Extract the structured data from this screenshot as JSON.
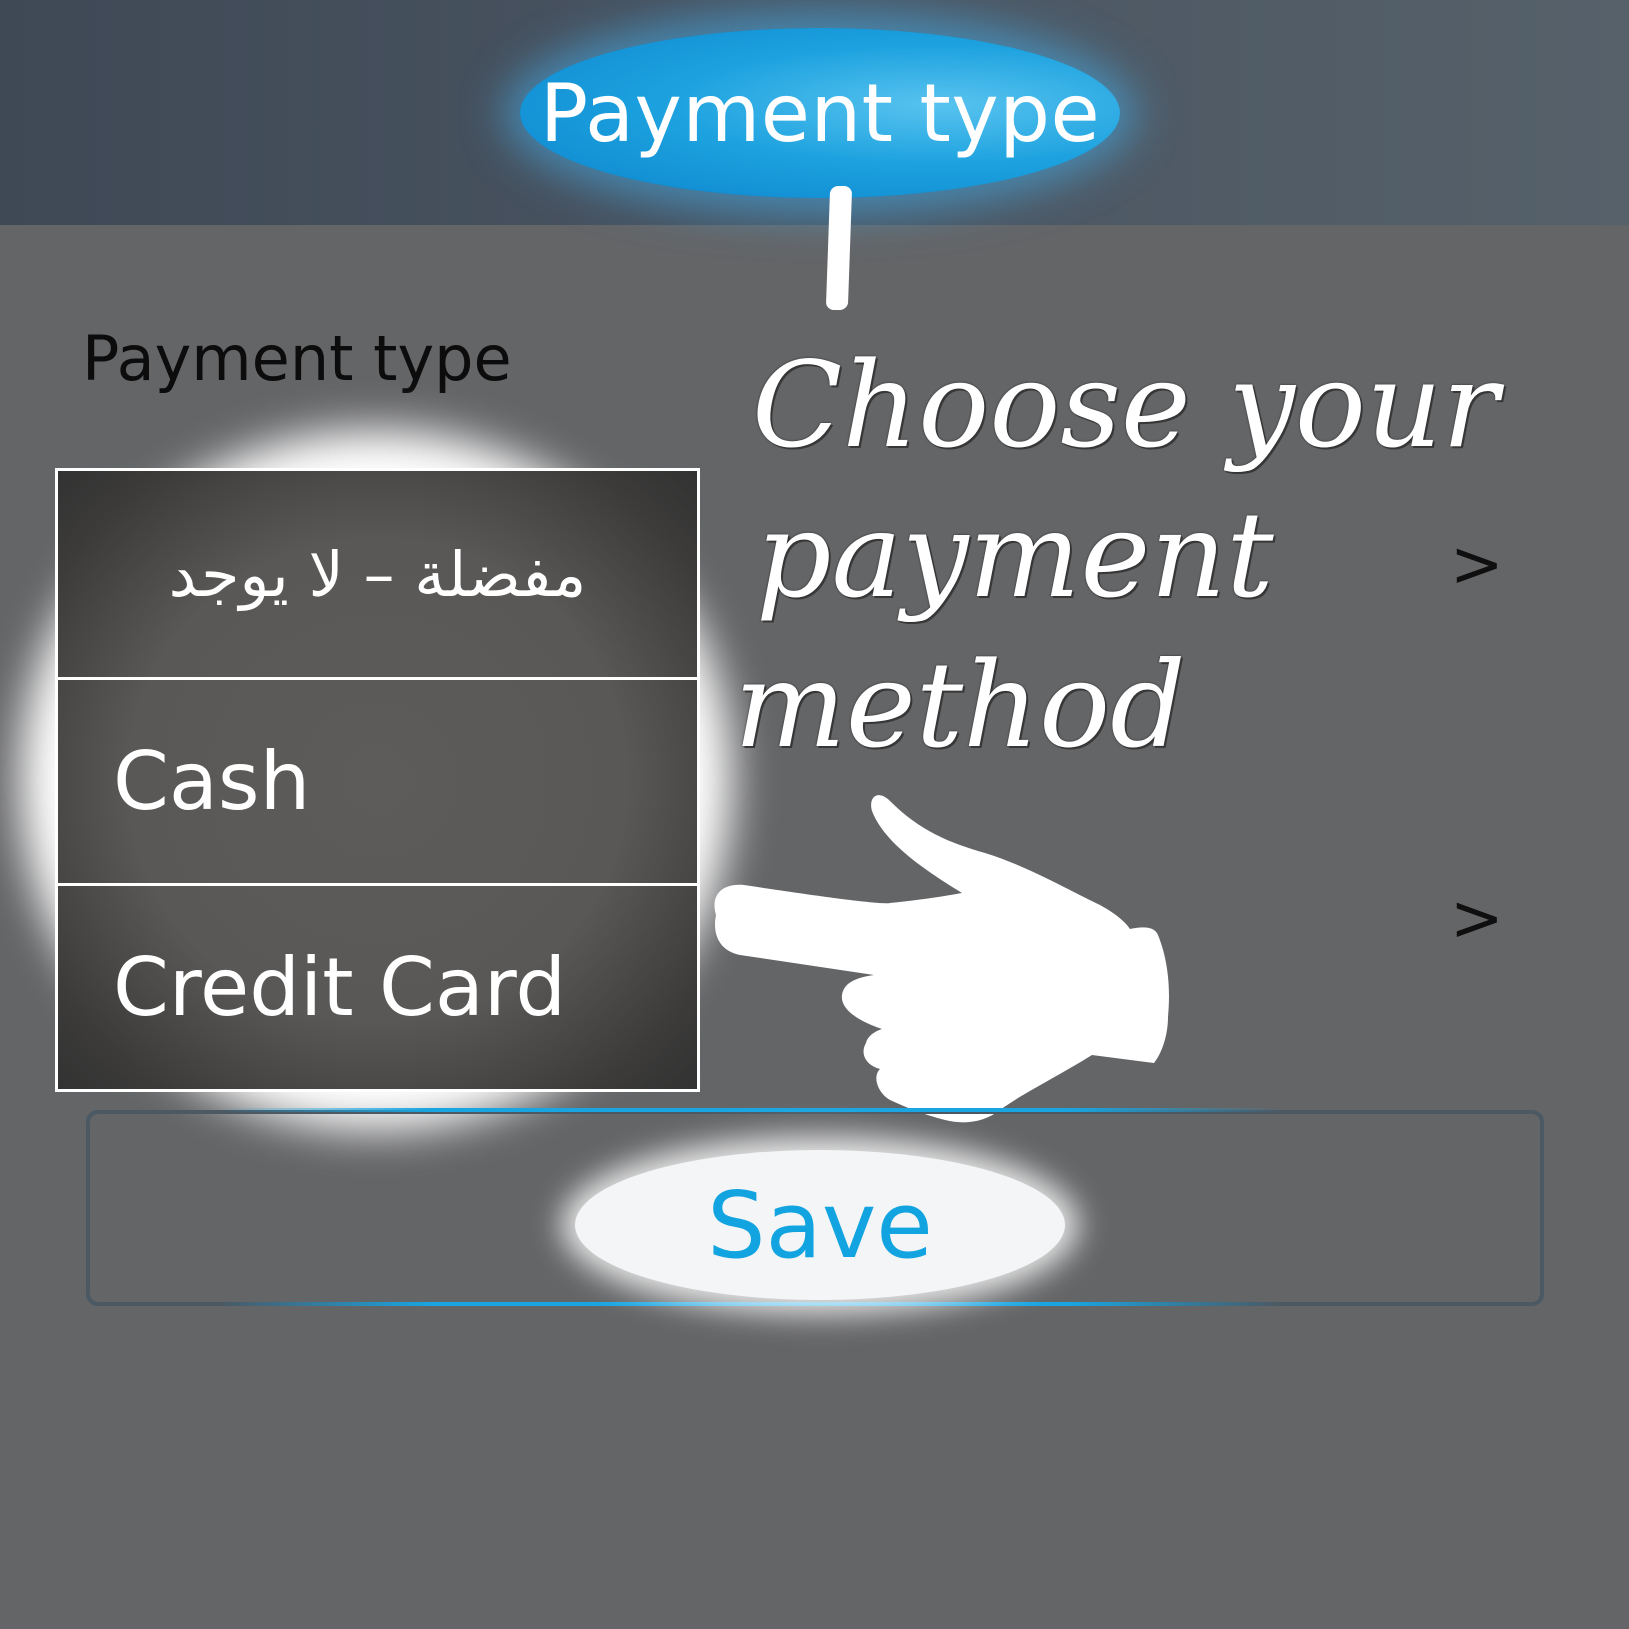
{
  "header": {
    "title": "Payment type"
  },
  "form": {
    "field_label": "Payment type",
    "dropdown": {
      "options": [
        {
          "label": "مفضلة – لا يوجد"
        },
        {
          "label": "Cash"
        },
        {
          "label": "Credit Card"
        }
      ]
    },
    "save_label": "Save"
  },
  "annotation": {
    "lines": [
      "Choose your",
      "payment",
      "method"
    ]
  },
  "icons": {
    "row_chevron": "chevron-right-icon",
    "pointer": "pointing-hand-icon"
  },
  "colors": {
    "title_bubble": "#1da2df",
    "save_text": "#12a4e0",
    "background": "#646567"
  }
}
